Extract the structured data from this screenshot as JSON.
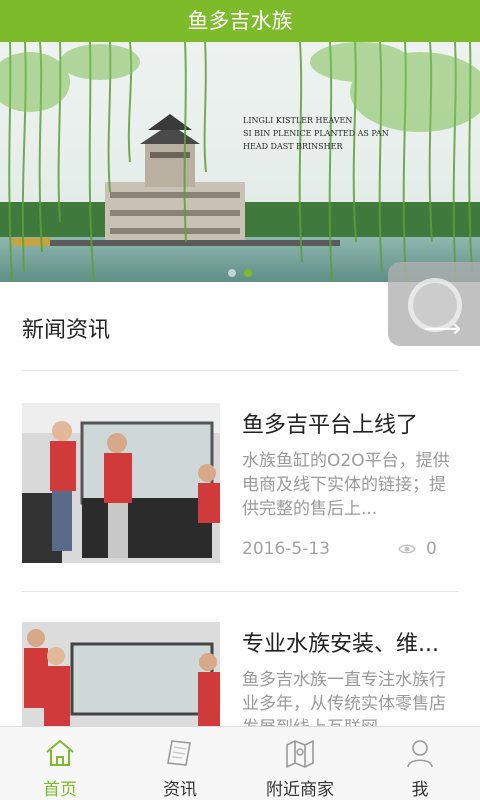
{
  "header": {
    "title": "鱼多吉水族"
  },
  "banner": {
    "caption_lines": [
      "LINGLI KISTLER HEAVEN",
      "SI BIN PLENICE PLANTED AS PAN",
      "HEAD DAST BRINSHER"
    ],
    "slide_count": 2,
    "active_slide": 1
  },
  "news": {
    "section_title": "新闻资讯",
    "items": [
      {
        "title": "鱼多吉平台上线了",
        "description": "水族鱼缸的O2O平台，提供电商及线下实体的链接；提供完整的售后上...",
        "date": "2016-5-13",
        "views": "0"
      },
      {
        "title": "专业水族安装、维...",
        "description": "鱼多吉水族一直专注水族行业多年，从传统实体零售店发展到线上互联网...",
        "date": "",
        "views": ""
      }
    ]
  },
  "tabbar": {
    "active_color": "#7dbb2a",
    "tabs": [
      {
        "label": "首页",
        "icon": "home-icon",
        "active": true
      },
      {
        "label": "资讯",
        "icon": "news-icon",
        "active": false
      },
      {
        "label": "附近商家",
        "icon": "map-icon",
        "active": false
      },
      {
        "label": "我",
        "icon": "user-icon",
        "active": false
      }
    ]
  },
  "colors": {
    "accent": "#7dbb2a",
    "muted_text": "#9a9a9a"
  }
}
